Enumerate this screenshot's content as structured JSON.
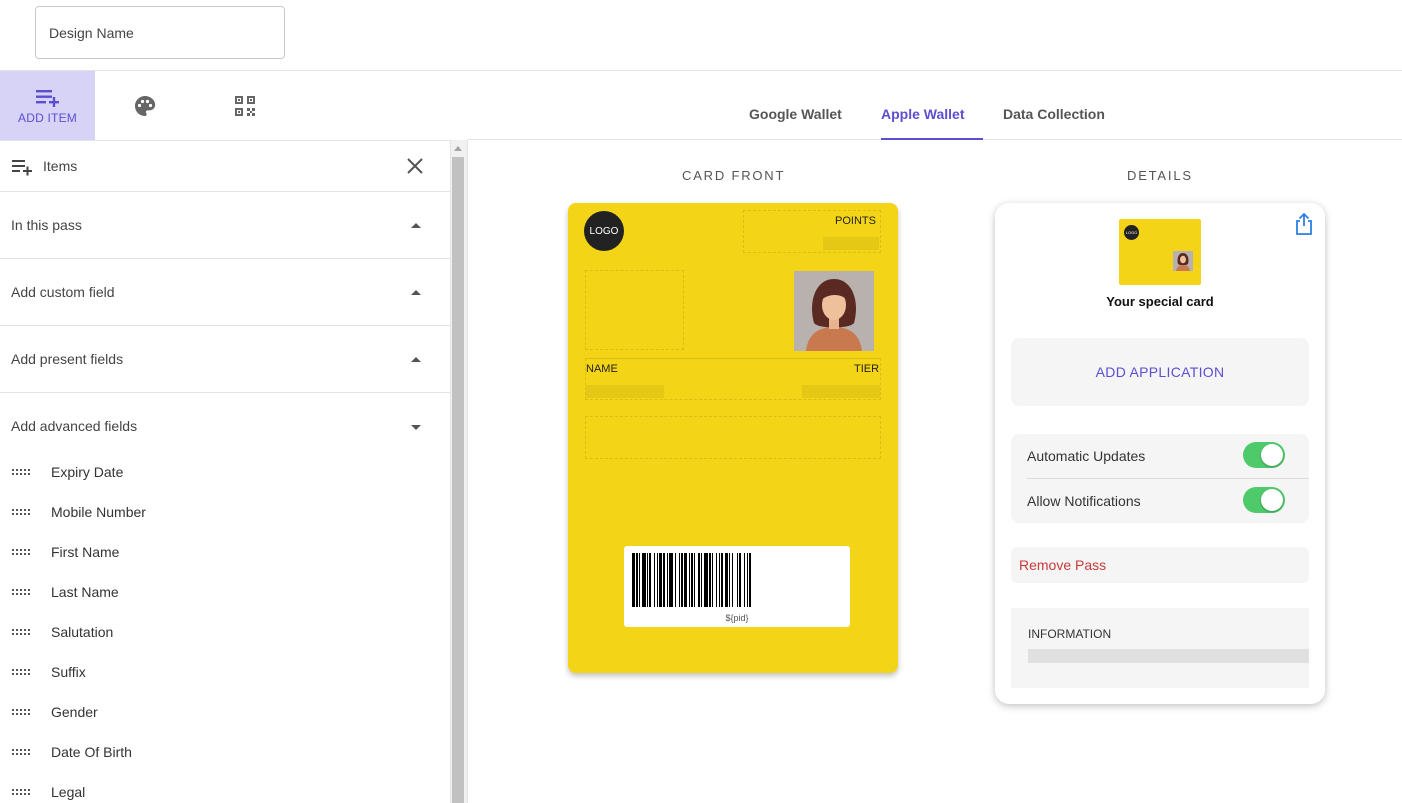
{
  "header": {
    "design_name_placeholder": "Design Name"
  },
  "tool_tabs": [
    {
      "label": "ADD ITEM",
      "icon": "playlist-add-icon",
      "active": true
    },
    {
      "label": "",
      "icon": "palette-icon",
      "active": false
    },
    {
      "label": "",
      "icon": "qr-code-icon",
      "active": false
    }
  ],
  "sidebar": {
    "title": "Items",
    "sections": [
      {
        "label": "In this pass",
        "expanded": false
      },
      {
        "label": "Add custom field",
        "expanded": false
      },
      {
        "label": "Add present fields",
        "expanded": false
      },
      {
        "label": "Add advanced fields",
        "expanded": true
      }
    ],
    "advanced_fields": [
      "Expiry Date",
      "Mobile Number",
      "First Name",
      "Last Name",
      "Salutation",
      "Suffix",
      "Gender",
      "Date Of Birth",
      "Legal"
    ]
  },
  "main_tabs": [
    {
      "label": "Google Wallet",
      "active": false
    },
    {
      "label": "Apple Wallet",
      "active": true
    },
    {
      "label": "Data Collection",
      "active": false
    }
  ],
  "card_front": {
    "heading": "CARD FRONT",
    "logo_text": "LOGO",
    "points_label": "POINTS",
    "name_label": "NAME",
    "tier_label": "TIER",
    "barcode_text": "${pid}",
    "background_color": "#f4d416"
  },
  "details": {
    "heading": "DETAILS",
    "mini_logo_text": "LOGO",
    "card_name": "Your special card",
    "add_application": "ADD APPLICATION",
    "settings": [
      {
        "label": "Automatic Updates",
        "on": true
      },
      {
        "label": "Allow Notifications",
        "on": true
      }
    ],
    "remove_pass": "Remove Pass",
    "information_label": "INFORMATION"
  },
  "colors": {
    "accent": "#5b4fcf",
    "toggle_on": "#4fca6b",
    "danger": "#c93a3a"
  }
}
